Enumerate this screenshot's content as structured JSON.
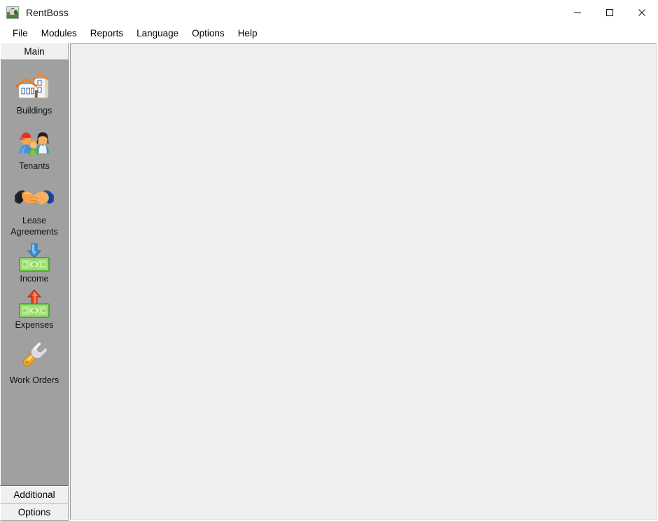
{
  "window": {
    "title": "RentBoss",
    "icon": "house-photo-icon",
    "controls": [
      {
        "name": "minimize-button",
        "glyph": "minimize-icon",
        "label": "Minimize"
      },
      {
        "name": "maximize-button",
        "glyph": "maximize-icon",
        "label": "Maximize"
      },
      {
        "name": "close-button",
        "glyph": "close-icon",
        "label": "Close"
      }
    ]
  },
  "menubar": {
    "items": [
      {
        "label": "File",
        "name": "menu-file"
      },
      {
        "label": "Modules",
        "name": "menu-modules"
      },
      {
        "label": "Reports",
        "name": "menu-reports"
      },
      {
        "label": "Language",
        "name": "menu-language"
      },
      {
        "label": "Options",
        "name": "menu-options"
      },
      {
        "label": "Help",
        "name": "menu-help"
      }
    ]
  },
  "sidebar": {
    "group_header": "Main",
    "items": [
      {
        "label": "Buildings",
        "icon": "house-icon"
      },
      {
        "label": "Tenants",
        "icon": "people-icon"
      },
      {
        "label": "Lease Agreements",
        "icon": "handshake-icon"
      },
      {
        "label": "Income",
        "icon": "money-in-icon"
      },
      {
        "label": "Expenses",
        "icon": "money-out-icon"
      },
      {
        "label": "Work Orders",
        "icon": "wrench-icon"
      }
    ],
    "bottom_bars": [
      {
        "label": "Additional",
        "name": "sidebar-bar-additional"
      },
      {
        "label": "Options",
        "name": "sidebar-bar-options"
      }
    ]
  },
  "main": {
    "content": ""
  },
  "colors": {
    "titlebar_bg": "#ffffff",
    "sidebar_pane_bg": "#a0a0a0",
    "bar_button_bg": "#f0f0f0",
    "content_bg": "#f0f0f0",
    "text": "#000000",
    "roof_orange": "#e8741c",
    "money_green": "#7ec850",
    "arrow_blue": "#4a90d9",
    "arrow_red": "#e03a1f",
    "wrench_gold": "#f0a81e",
    "wrench_silver": "#d8d8dc"
  }
}
